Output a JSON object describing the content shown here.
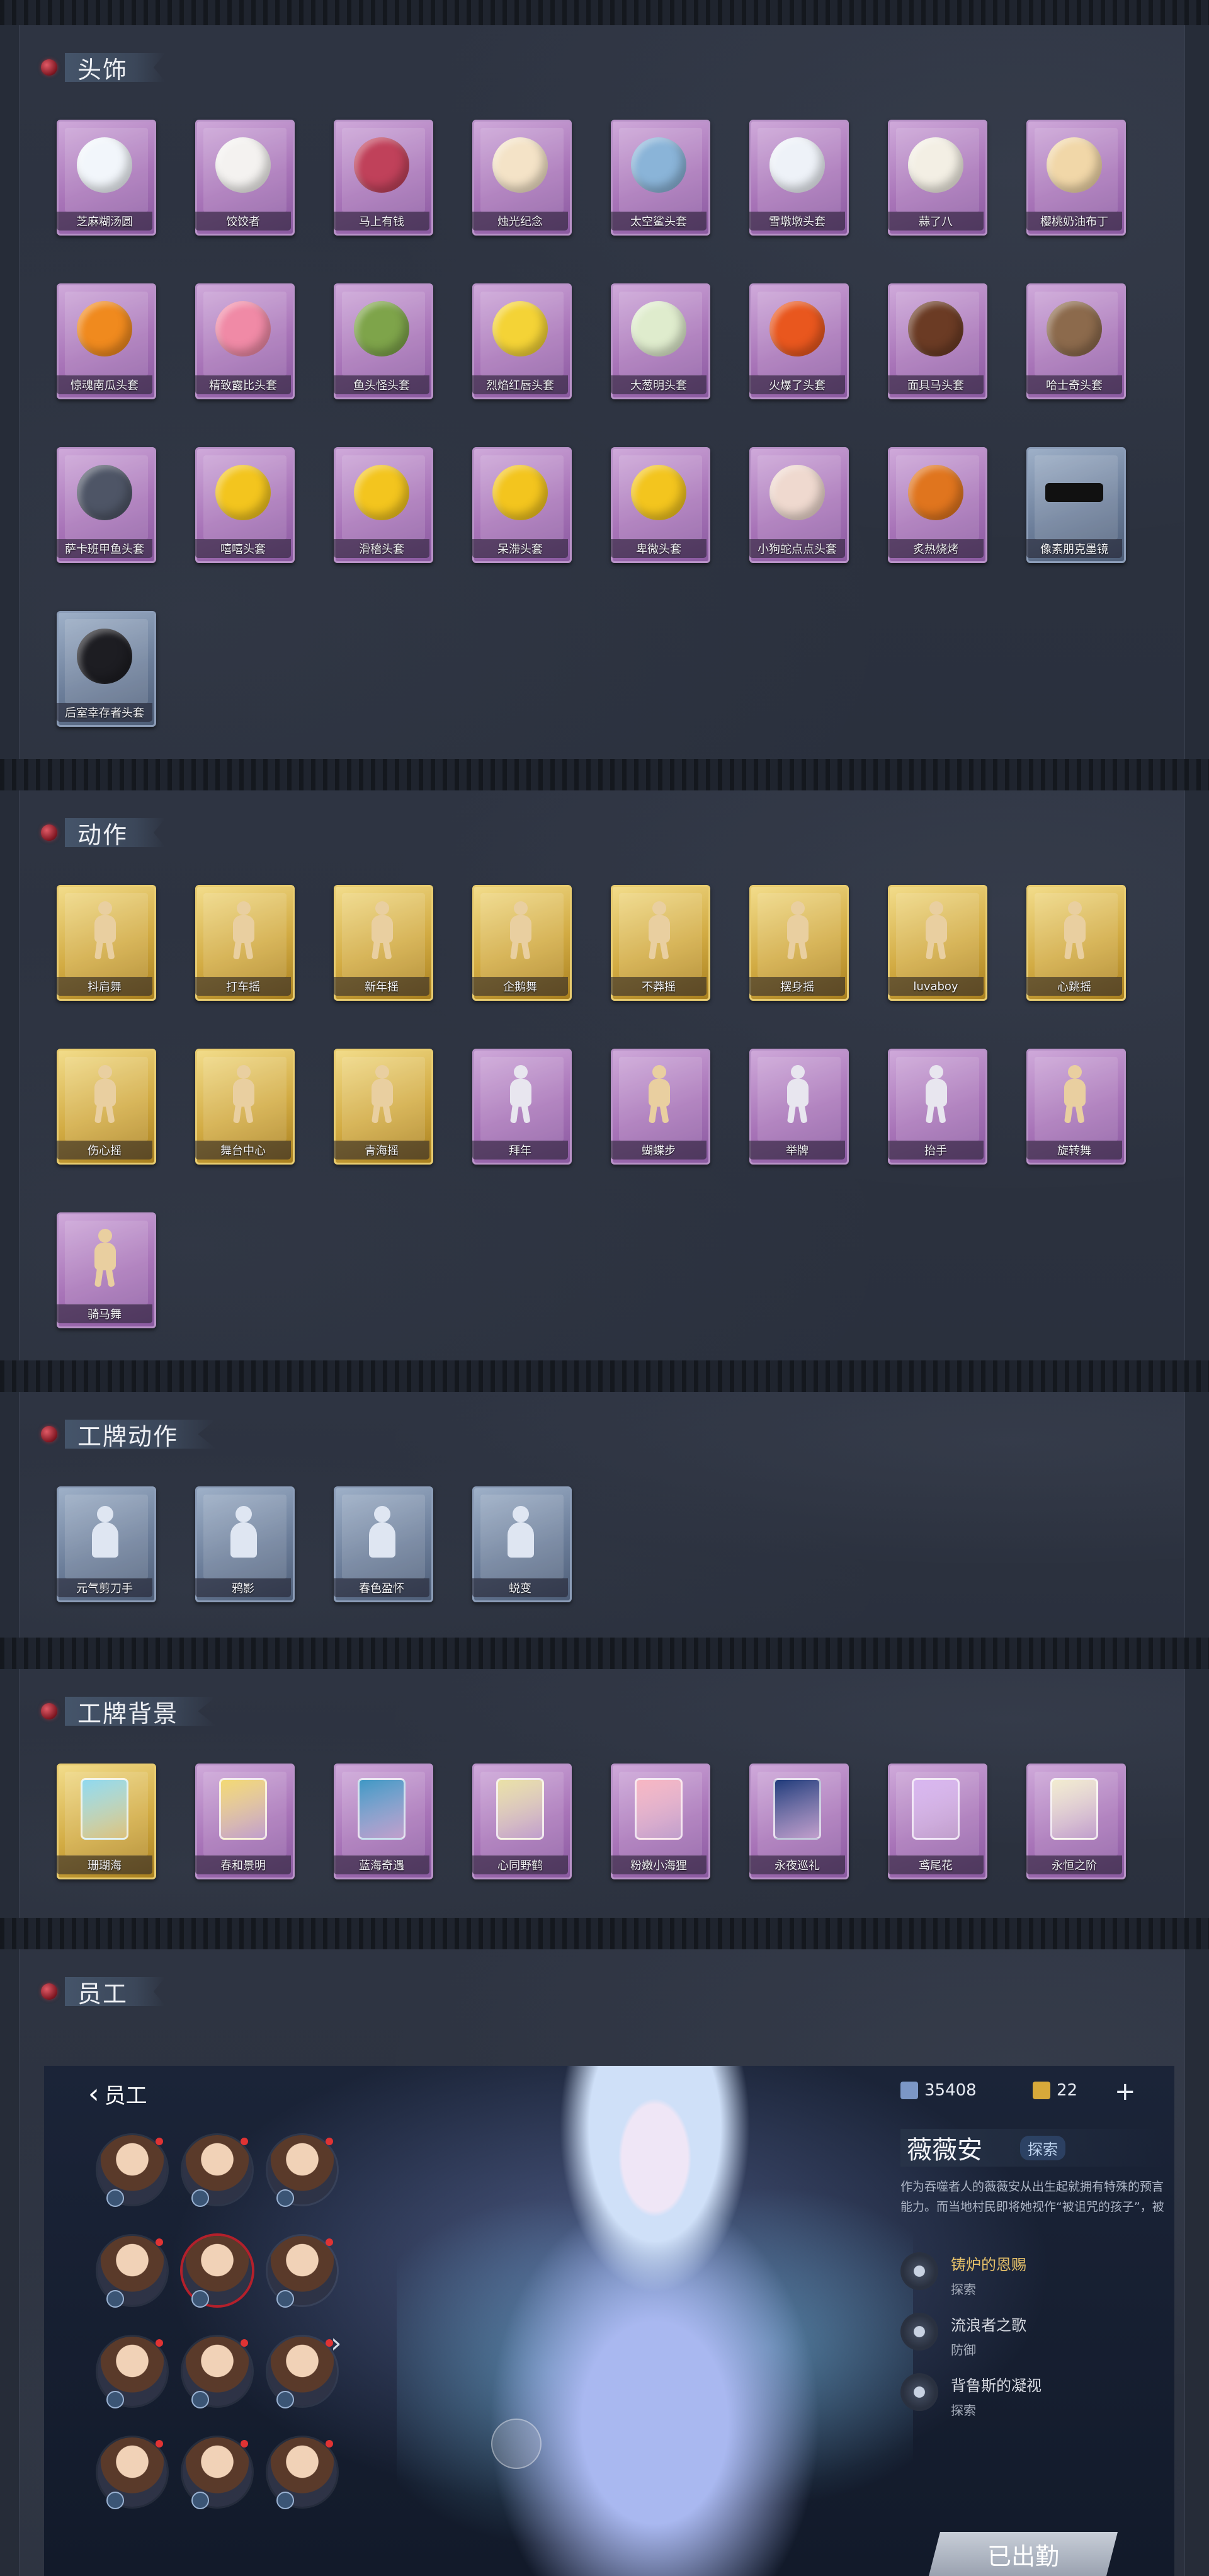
{
  "sections": {
    "headwear": {
      "title": "头饰",
      "items": [
        {
          "label": "芝麻糊汤圆",
          "rarity": "purple",
          "icon": "tangyuan-icon",
          "color": "#f2f6fb"
        },
        {
          "label": "饺饺者",
          "rarity": "purple",
          "icon": "dumpling-icon",
          "color": "#f4f2f0"
        },
        {
          "label": "马上有钱",
          "rarity": "purple",
          "icon": "horse-head-icon",
          "color": "#c0415a"
        },
        {
          "label": "烛光纪念",
          "rarity": "purple",
          "icon": "candle-icon",
          "color": "#f4e3c7"
        },
        {
          "label": "太空鲨头套",
          "rarity": "purple",
          "icon": "shark-head-icon",
          "color": "#8ab4d8"
        },
        {
          "label": "雪墩墩头套",
          "rarity": "purple",
          "icon": "snowman-icon",
          "color": "#eef2f8"
        },
        {
          "label": "蒜了八",
          "rarity": "purple",
          "icon": "garlic-icon",
          "color": "#f3efe4"
        },
        {
          "label": "樱桃奶油布丁",
          "rarity": "purple",
          "icon": "pudding-icon",
          "color": "#f1d7a8"
        },
        {
          "label": "惊魂南瓜头套",
          "rarity": "purple",
          "icon": "pumpkin-icon",
          "color": "#f08a1e"
        },
        {
          "label": "精致露比头套",
          "rarity": "purple",
          "icon": "pink-creature-icon",
          "color": "#f08aa6"
        },
        {
          "label": "鱼头怪头套",
          "rarity": "purple",
          "icon": "fish-head-icon",
          "color": "#7ea44a"
        },
        {
          "label": "烈焰红唇头套",
          "rarity": "purple",
          "icon": "yellow-mouse-icon",
          "color": "#f4d336"
        },
        {
          "label": "大葱明头套",
          "rarity": "purple",
          "icon": "leek-icon",
          "color": "#dfeccd"
        },
        {
          "label": "火爆了头套",
          "rarity": "purple",
          "icon": "fireball-icon",
          "color": "#e9571e"
        },
        {
          "label": "面具马头套",
          "rarity": "purple",
          "icon": "horse-mask-icon",
          "color": "#6b3b24"
        },
        {
          "label": "哈士奇头套",
          "rarity": "purple",
          "icon": "husky-icon",
          "color": "#8c6a4c"
        },
        {
          "label": "萨卡班甲鱼头套",
          "rarity": "purple",
          "icon": "fish-icon",
          "color": "#4e5566"
        },
        {
          "label": "嘻嘻头套",
          "rarity": "purple",
          "icon": "grin-emoji-icon",
          "color": "#f3c51e"
        },
        {
          "label": "滑稽头套",
          "rarity": "purple",
          "icon": "smirk-emoji-icon",
          "color": "#f3c51e"
        },
        {
          "label": "呆滞头套",
          "rarity": "purple",
          "icon": "stare-emoji-icon",
          "color": "#f3c51e"
        },
        {
          "label": "卑微头套",
          "rarity": "purple",
          "icon": "meek-emoji-icon",
          "color": "#f3c51e"
        },
        {
          "label": "小狗蛇点点头套",
          "rarity": "purple",
          "icon": "snake-head-icon",
          "color": "#efd9cf"
        },
        {
          "label": "炙热烧烤",
          "rarity": "purple",
          "icon": "grill-icon",
          "color": "#e0751e"
        },
        {
          "label": "像素朋克墨镜",
          "rarity": "blue",
          "icon": "pixel-sunglasses-icon",
          "color": "#111111"
        },
        {
          "label": "后室幸存者头套",
          "rarity": "blue",
          "icon": "gas-mask-icon",
          "color": "#1d1d22"
        }
      ]
    },
    "actions": {
      "title": "动作",
      "items": [
        {
          "label": "抖肩舞",
          "rarity": "gold",
          "icon": "dance-pose-icon"
        },
        {
          "label": "打车摇",
          "rarity": "gold",
          "icon": "dance-pose-icon"
        },
        {
          "label": "新年摇",
          "rarity": "gold",
          "icon": "dance-pose-icon"
        },
        {
          "label": "企鹅舞",
          "rarity": "gold",
          "icon": "dance-pose-icon"
        },
        {
          "label": "不莽摇",
          "rarity": "gold",
          "icon": "dance-pose-icon"
        },
        {
          "label": "摆身摇",
          "rarity": "gold",
          "icon": "dance-pose-icon"
        },
        {
          "label": "luvaboy",
          "rarity": "gold",
          "icon": "dance-pose-icon"
        },
        {
          "label": "心跳摇",
          "rarity": "gold",
          "icon": "dance-pose-icon"
        },
        {
          "label": "伤心摇",
          "rarity": "gold",
          "icon": "dance-pose-icon"
        },
        {
          "label": "舞台中心",
          "rarity": "gold",
          "icon": "dance-pose-icon"
        },
        {
          "label": "青海摇",
          "rarity": "gold",
          "icon": "dance-pose-icon"
        },
        {
          "label": "拜年",
          "rarity": "purple",
          "icon": "ghost-pose-icon"
        },
        {
          "label": "蝴蝶步",
          "rarity": "purple",
          "icon": "dance-pose-icon"
        },
        {
          "label": "举牌",
          "rarity": "purple",
          "icon": "ghost-pose-icon"
        },
        {
          "label": "抬手",
          "rarity": "purple",
          "icon": "ghost-pose-icon"
        },
        {
          "label": "旋转舞",
          "rarity": "purple",
          "icon": "dance-pose-icon"
        },
        {
          "label": "骑马舞",
          "rarity": "purple",
          "icon": "dance-pose-icon"
        }
      ]
    },
    "badge_actions": {
      "title": "工牌动作",
      "items": [
        {
          "label": "元气剪刀手",
          "rarity": "blue",
          "icon": "silhouette-icon"
        },
        {
          "label": "鸦影",
          "rarity": "blue",
          "icon": "silhouette-icon"
        },
        {
          "label": "春色盈怀",
          "rarity": "blue",
          "icon": "silhouette-icon"
        },
        {
          "label": "蜕变",
          "rarity": "blue",
          "icon": "silhouette-icon"
        }
      ]
    },
    "badge_backgrounds": {
      "title": "工牌背景",
      "items": [
        {
          "label": "珊瑚海",
          "rarity": "gold",
          "icon": "card-plate-icon",
          "color": "#8fd8ee"
        },
        {
          "label": "春和景明",
          "rarity": "purple",
          "icon": "card-plate-icon",
          "color": "#f2d873"
        },
        {
          "label": "蓝海奇遇",
          "rarity": "purple",
          "icon": "card-plate-icon",
          "color": "#3f97c4"
        },
        {
          "label": "心同野鹤",
          "rarity": "purple",
          "icon": "card-plate-icon",
          "color": "#e9e0a6"
        },
        {
          "label": "粉嫩小海狸",
          "rarity": "purple",
          "icon": "card-plate-icon",
          "color": "#f7b6c2"
        },
        {
          "label": "永夜巡礼",
          "rarity": "purple",
          "icon": "card-plate-icon",
          "color": "#1f3a7a"
        },
        {
          "label": "鸢尾花",
          "rarity": "purple",
          "icon": "card-plate-icon",
          "color": "#d8b6f0"
        },
        {
          "label": "永恒之阶",
          "rarity": "purple",
          "icon": "card-plate-icon",
          "color": "#f1ebcf"
        }
      ]
    },
    "staff": {
      "title": "员工"
    }
  },
  "staff_screen": {
    "back_label": "员工",
    "currency_1": "35408",
    "currency_2": "22",
    "plus": "+",
    "character_name": "薇薇安",
    "character_tag": "探索",
    "description": "作为吞噬者人的薇薇安从出生起就拥有特殊的预言能力。而当地村民即将她视作“被诅咒的孩子”，被",
    "traits": [
      {
        "name": "铸炉的恩赐",
        "type": "探索"
      },
      {
        "name": "流浪者之歌",
        "type": "防御"
      },
      {
        "name": "背鲁斯的凝视",
        "type": "探索"
      }
    ],
    "dispatch_label": "已出勤",
    "rarity_colors": {
      "purple": "#b07cc2",
      "gold": "#d9b24c",
      "blue": "#7a8ca8"
    }
  }
}
